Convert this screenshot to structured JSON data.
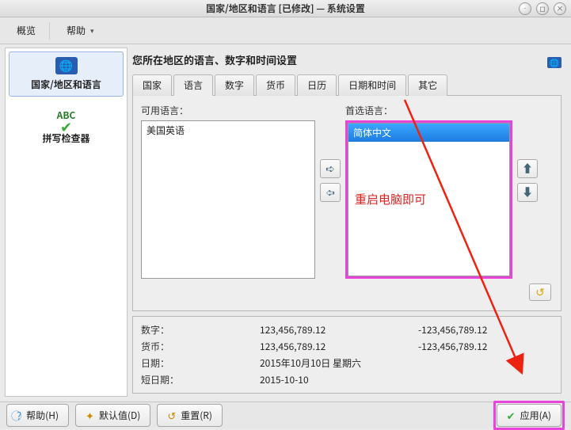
{
  "window": {
    "title": "国家/地区和语言 [已修改] — 系统设置"
  },
  "toolbar": {
    "overview": "概览",
    "help": "帮助"
  },
  "sidebar": {
    "item0_label": "国家/地区和语言",
    "item1_abc": "ABC",
    "item1_label": "拼写检查器"
  },
  "main": {
    "heading": "您所在地区的语言、数字和时间设置"
  },
  "tabs": {
    "t0": "国家",
    "t1": "语言",
    "t2": "数字",
    "t3": "货币",
    "t4": "日历",
    "t5": "日期和时间",
    "t6": "其它"
  },
  "panel": {
    "available_label": "可用语言：",
    "preferred_label": "首选语言：",
    "available_items": {
      "0": "美国英语"
    },
    "preferred_items": {
      "0": "简体中文"
    }
  },
  "annotation": {
    "text": "重启电脑即可"
  },
  "summary": {
    "rows": {
      "number": {
        "label": "数字：",
        "v1": "123,456,789.12",
        "v2": "-123,456,789.12"
      },
      "currency": {
        "label": "货币：",
        "v1": "123,456,789.12",
        "v2": "-123,456,789.12"
      },
      "date": {
        "label": "日期：",
        "v1": "2015年10月10日 星期六",
        "v2": ""
      },
      "shortdate": {
        "label": "短日期：",
        "v1": "2015-10-10",
        "v2": ""
      }
    }
  },
  "buttons": {
    "help": "帮助(H)",
    "defaults": "默认值(D)",
    "reset": "重置(R)",
    "apply": "应用(A)"
  }
}
